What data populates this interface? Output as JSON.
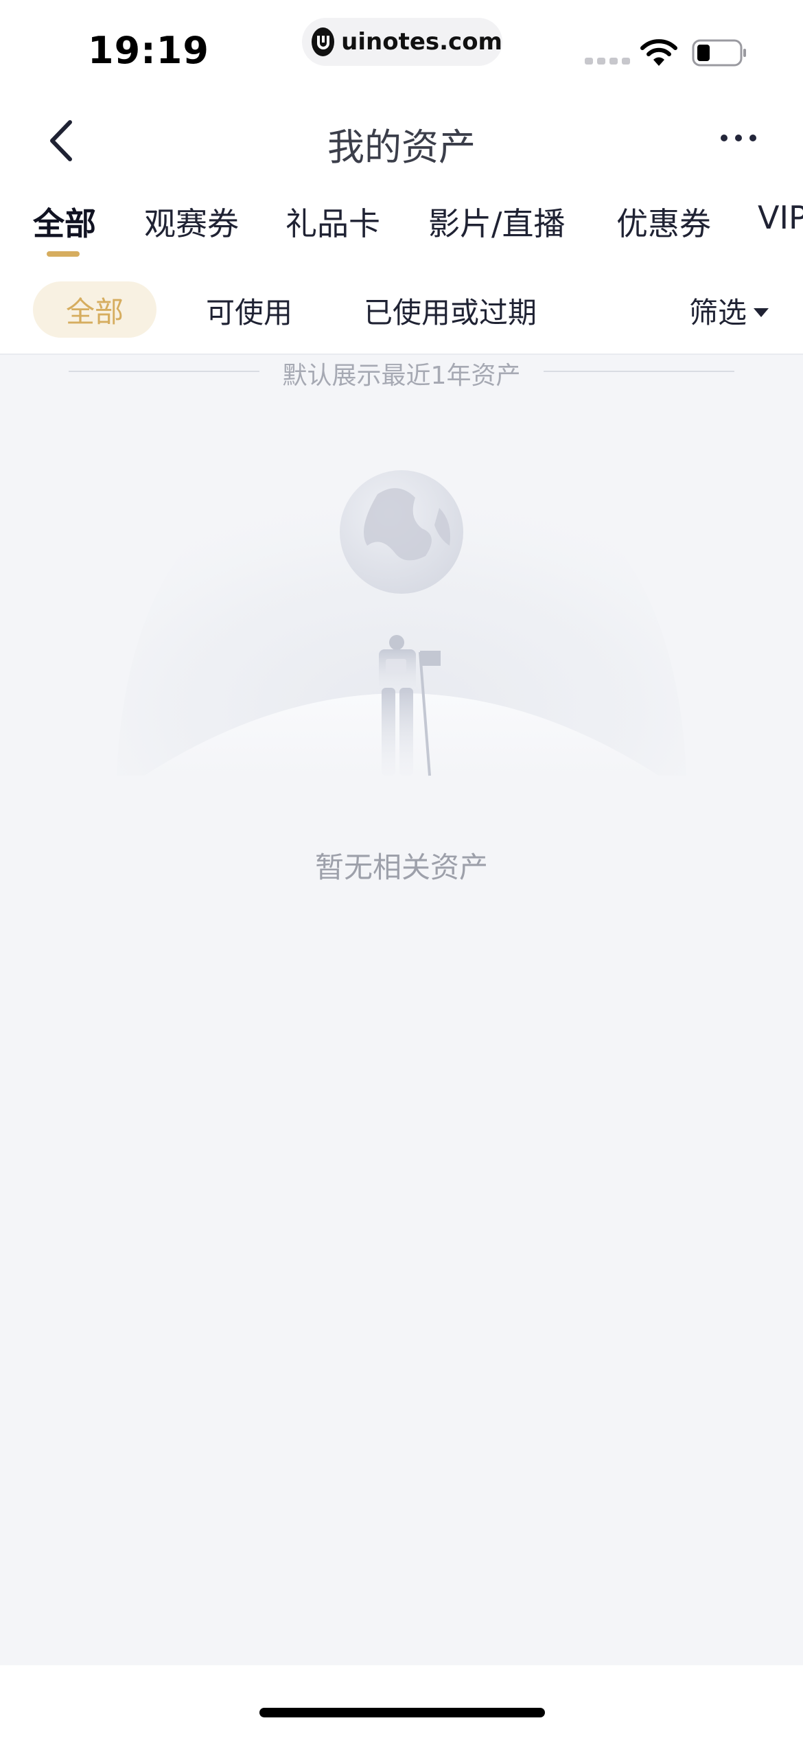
{
  "status_bar": {
    "time": "19:19",
    "url": "uinotes.com"
  },
  "nav": {
    "title": "我的资产"
  },
  "tabs": [
    {
      "label": "全部",
      "active": true
    },
    {
      "label": "观赛券",
      "active": false
    },
    {
      "label": "礼品卡",
      "active": false
    },
    {
      "label": "影片/直播",
      "active": false
    },
    {
      "label": "优惠券",
      "active": false
    },
    {
      "label": "VIP",
      "active": false
    }
  ],
  "filters": {
    "chips": [
      "全部",
      "可使用",
      "已使用或过期"
    ],
    "filter_label": "筛选"
  },
  "notice": "默认展示最近1年资产",
  "empty_state": {
    "message": "暂无相关资产"
  },
  "colors": {
    "accent": "#d6ad5f",
    "accent_bg": "#f8f1e2",
    "page_bg": "#f4f5f8"
  }
}
